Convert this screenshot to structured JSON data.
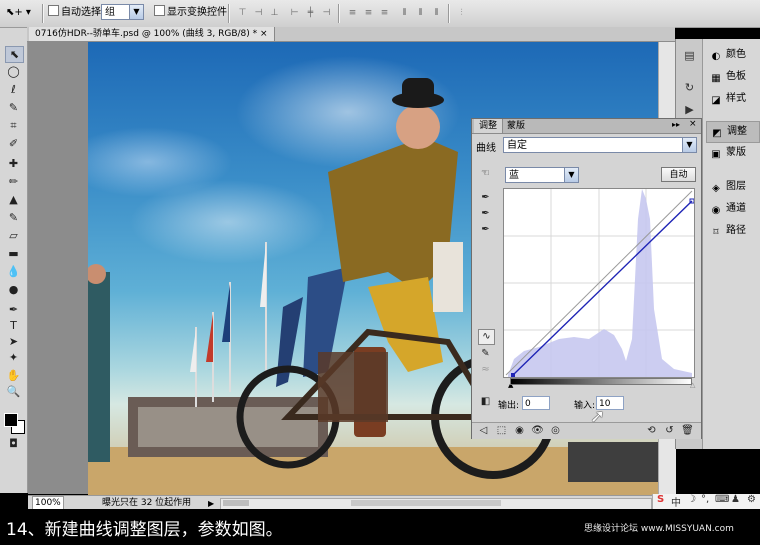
{
  "options_bar": {
    "auto_select_label": "自动选择:",
    "auto_select_value": "组",
    "show_transform_label": "显示变换控件"
  },
  "document": {
    "tab_title": "0716仿HDR--骄单车.psd @ 100% (曲线 3, RGB/8) *",
    "tab_close": "×",
    "zoom": "100%",
    "status_text": "曝光只在 32 位起作用"
  },
  "dock": {
    "items": [
      {
        "label": "颜色",
        "icon": "color-icon"
      },
      {
        "label": "色板",
        "icon": "swatches-icon"
      },
      {
        "label": "样式",
        "icon": "styles-icon"
      },
      {
        "label": "调整",
        "icon": "adjustments-icon"
      },
      {
        "label": "蒙版",
        "icon": "masks-icon"
      },
      {
        "label": "图层",
        "icon": "layers-icon"
      },
      {
        "label": "通道",
        "icon": "channels-icon"
      },
      {
        "label": "路径",
        "icon": "paths-icon"
      }
    ]
  },
  "adjustments_panel": {
    "tab_adjust": "调整",
    "tab_mask": "蒙版",
    "type_label": "曲线",
    "preset_value": "自定",
    "channel_value": "蓝",
    "auto_button": "自动",
    "output_label": "输出:",
    "output_value": "0",
    "input_label": "输入:",
    "input_value": "10"
  },
  "caption": {
    "text": "14、新建曲线调整图层，参数如图。",
    "watermark": "思缘设计论坛 www.MISSYUAN.com"
  }
}
